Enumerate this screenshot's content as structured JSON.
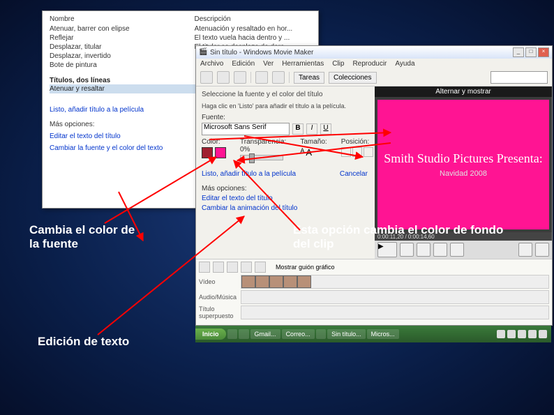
{
  "domain": "Computer-Use",
  "back_window": {
    "col_headers": [
      "Nombre",
      "Descripción"
    ],
    "names": [
      "Atenuar, barrer con elipse",
      "Reflejar",
      "Desplazar, titular",
      "Desplazar, invertido",
      "Bote de pintura"
    ],
    "descs": [
      "Atenuación y resaltado en hor...",
      "El texto vuela hacia dentro y ...",
      "El titular se desplaza de dere..."
    ],
    "section_title": "Títulos, dos líneas",
    "selected_item": "Atenuar y resaltar",
    "done_link": "Listo, añadir título a la película",
    "more_options_label": "Más opciones:",
    "edit_text_link": "Editar el texto del título",
    "change_font_link": "Cambiar la fuente y el color del texto"
  },
  "front_window": {
    "title": "Sin título - Windows Movie Maker",
    "menu": [
      "Archivo",
      "Edición",
      "Ver",
      "Herramientas",
      "Clip",
      "Reproducir",
      "Ayuda"
    ],
    "toolbar_label": "Tareas",
    "collections_label": "Colecciones",
    "task": {
      "instruction": "Seleccione la fuente y el color del título",
      "subtext": "Haga clic en 'Listo' para añadir el título a la película.",
      "font_label": "Fuente:",
      "font_value": "Microsoft Sans Serif",
      "color_label": "Color:",
      "transparency_label": "Transparencia: 0%",
      "size_label": "Tamaño:",
      "position_label": "Posición:",
      "done": "Listo, añadir título a la película",
      "cancel": "Cancelar",
      "more_options": "Más opciones:",
      "edit_text": "Editar el texto del título",
      "change_anim": "Cambiar la animación del título"
    },
    "preview": {
      "panel_title": "Alternar y mostrar",
      "line1": "Smith Studio Pictures Presenta:",
      "line2": "Navidad 2008",
      "time": "0:00:11,20 / 0:00:14,60"
    },
    "timeline": {
      "scale_label": "Mostrar guión gráfico",
      "video_track": "Vídeo",
      "audio_track": "Audio/Música",
      "overlay_track": "Título superpuesto"
    },
    "taskbar": {
      "start": "Inicio",
      "items": [
        "",
        "",
        "Gmail...",
        "Correo...",
        "",
        "Sin título...",
        "Micros..."
      ]
    }
  },
  "annotations": {
    "change_color": "Cambia el color de la fuente",
    "bg_color": "Esta opción cambia el color de fondo del clip",
    "edit_text": "Edición de texto"
  },
  "colors": {
    "font_swatch": "#a02030",
    "bg_swatch": "#ff1493"
  }
}
